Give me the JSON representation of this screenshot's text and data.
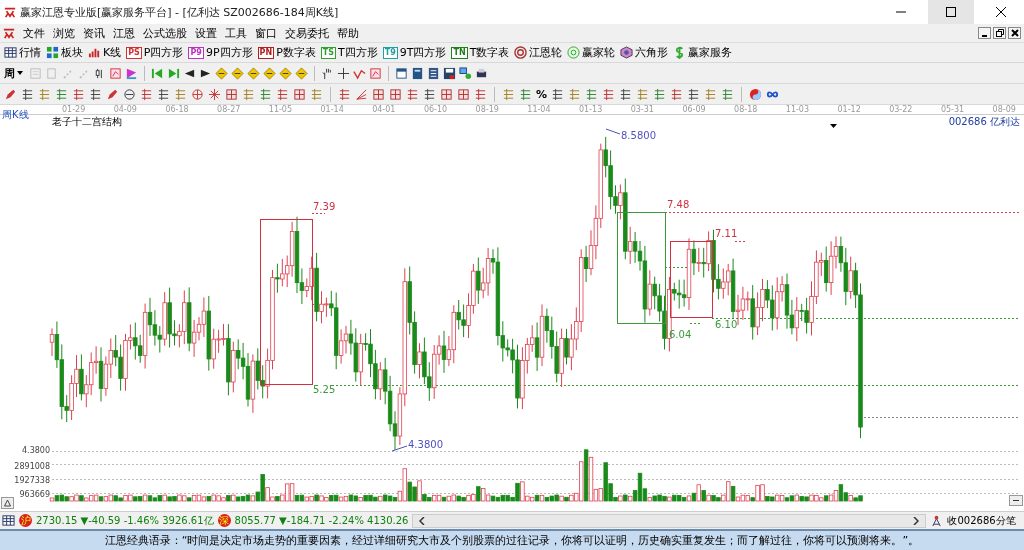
{
  "window": {
    "title": "赢家江恩专业版[赢家服务平台] - [亿利达  SZ002686-184周K线]"
  },
  "menu": [
    "文件",
    "浏览",
    "资讯",
    "江恩",
    "公式选股",
    "设置",
    "工具",
    "窗口",
    "交易委托",
    "帮助"
  ],
  "toolbar": [
    {
      "label": "行情",
      "kind": "grid"
    },
    {
      "label": "板块",
      "kind": "blocks"
    },
    {
      "label": "K线",
      "kind": "bars"
    },
    {
      "label": "P四方形",
      "kind": "badge",
      "badge": "PS",
      "color": "#d03030"
    },
    {
      "label": "9P四方形",
      "kind": "badge",
      "badge": "P9",
      "color": "#c030c0"
    },
    {
      "label": "P数字表",
      "kind": "badge",
      "badge": "PN",
      "color": "#b02020"
    },
    {
      "label": "T四方形",
      "kind": "badge",
      "badge": "TS",
      "color": "#30a030"
    },
    {
      "label": "9T四方形",
      "kind": "badge",
      "badge": "T9",
      "color": "#20a0a0"
    },
    {
      "label": "T数字表",
      "kind": "badge",
      "badge": "TN",
      "color": "#208020"
    },
    {
      "label": "江恩轮",
      "kind": "target"
    },
    {
      "label": "赢家轮",
      "kind": "wheel"
    },
    {
      "label": "六角形",
      "kind": "hexagon"
    },
    {
      "label": "赢家服务",
      "kind": "dollar"
    }
  ],
  "period_dropdown": {
    "value": "周"
  },
  "drawing_tools": {
    "percent": "%"
  },
  "chart": {
    "period_label": "周K线",
    "dates": [
      "01-29",
      "04-09",
      "06-18",
      "08-27",
      "11-05",
      "01-14",
      "04-01",
      "06-10",
      "08-19",
      "11-04",
      "01-13",
      "03-31",
      "06-09",
      "08-18",
      "11-03",
      "01-12",
      "03-22",
      "05-31",
      "08-09"
    ],
    "structure_label": "老子十二宫结构",
    "stock_label": "002686  亿利达",
    "price_tick": "4.3800",
    "volume_ticks": [
      "2891008",
      "1927338",
      "963669"
    ],
    "annotations": [
      {
        "text": "7.39",
        "kind": "high"
      },
      {
        "text": "5.25",
        "kind": "low"
      },
      {
        "text": "8.5800",
        "kind": "extreme"
      },
      {
        "text": "4.3800",
        "kind": "extreme"
      },
      {
        "text": "7.48",
        "kind": "high"
      },
      {
        "text": "6.04",
        "kind": "low"
      },
      {
        "text": "7.11",
        "kind": "high"
      },
      {
        "text": "6.10",
        "kind": "low"
      }
    ]
  },
  "status_bar": {
    "indices": [
      {
        "badge": "沪",
        "text": "2730.15 ▼-40.59 -1.46% 3926.61亿"
      },
      {
        "badge": "深",
        "text": "8055.77 ▼-184.71 -2.24% 4130.26"
      }
    ],
    "tick_label": "收002686分笔"
  },
  "quote": "江恩经典语录：“时间是决定市场走势的重要因素，经过详细研究大市及个别股票的过往记录，你将可以证明，历史确实重复发生；而了解过往，你将可以预测将来。”。"
}
